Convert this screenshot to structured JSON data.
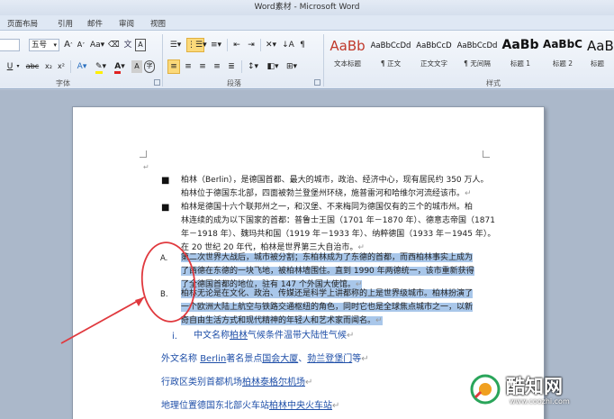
{
  "window": {
    "title": "Word素材 - Microsoft Word"
  },
  "tabs": [
    "页面布局",
    "引用",
    "邮件",
    "审阅",
    "视图"
  ],
  "ribbon": {
    "font_size": "五号",
    "grow_font": "A",
    "shrink_font": "A",
    "font_color_letter": "A",
    "highlight_letter": "A",
    "groups": {
      "font": "字体",
      "paragraph": "段落",
      "styles": "样式"
    },
    "styles": [
      {
        "sample": "AaBb",
        "name": "文本标题"
      },
      {
        "sample": "AaBbCcDd",
        "name": "¶ 正文"
      },
      {
        "sample": "AaBbCcD",
        "name": "正文文字"
      },
      {
        "sample": "AaBbCcDd",
        "name": "¶ 无间隔"
      },
      {
        "sample": "AaBb",
        "name": "标题 1"
      },
      {
        "sample": "AaBbC",
        "name": "标题 2"
      },
      {
        "sample": "AaBb",
        "name": "标题"
      }
    ]
  },
  "document": {
    "bullets": [
      {
        "line1": "柏林（Berlin），是德国首都、最大的城市，政治、经济中心，现有居民约 350 万人。",
        "line2": "柏林位于德国东北部，四面被勃兰登堡州环绕，施普雷河和哈维尔河流经该市。"
      },
      {
        "line1": "柏林是德国十六个联邦州之一，和汉堡、不来梅同为德国仅有的三个的城市州。柏",
        "line2": "林连续的成为以下国家的首都：普鲁士王国（1701 年－1870 年）、德意志帝国（1871",
        "line3": "年－1918 年）、魏玛共和国（1919 年－1933 年）、纳粹德国（1933 年－1945 年）。",
        "line4": "在 20 世纪 20 年代，柏林是世界第三大自治市。"
      }
    ],
    "numbered": [
      {
        "marker": "A.",
        "lines": [
          "第二次世界大战后，城市被分割；东柏林成为了东德的首都，而西柏林事实上成为",
          "了西德在东德的一块飞地，被柏林墙围住。直到 1990 年两德统一，该市重新获得",
          "了全德国首都的地位，驻有 147 个外国大使馆。"
        ]
      },
      {
        "marker": "B.",
        "lines": [
          "柏林无论是在文化、政治、传媒还是科学上讲都称的上是世界级城市。柏林扮演了",
          "一个欧洲大陆上航空与铁路交通枢纽的角色，同时它也是全球焦点城市之一，以新",
          "奇自由生活方式和现代精神的年轻人和艺术家而闻名。"
        ]
      }
    ],
    "roman_item": {
      "marker": "i.",
      "prefix": "中文名称",
      "link": "柏林",
      "suffix": "气候条件温带大陆性气候"
    },
    "info_lines": [
      {
        "a": "外文名称 ",
        "l1": "Berlin",
        "b": "著名景点",
        "l2": "国会大厦",
        "c": "、",
        "l3": "勃兰登堡门",
        "d": "等"
      },
      {
        "a": "行政区类别首都机场",
        "l1": "柏林泰格尔机场"
      },
      {
        "a": "地理位置德国东北部火车站",
        "l1": "柏林中央火车站"
      }
    ]
  },
  "watermark": {
    "brand": "酷知网",
    "url": "www.coozhi.com"
  },
  "colors": {
    "selection": "#a9c7ea",
    "annotation": "#e0393e",
    "link": "#1f4fa8"
  }
}
